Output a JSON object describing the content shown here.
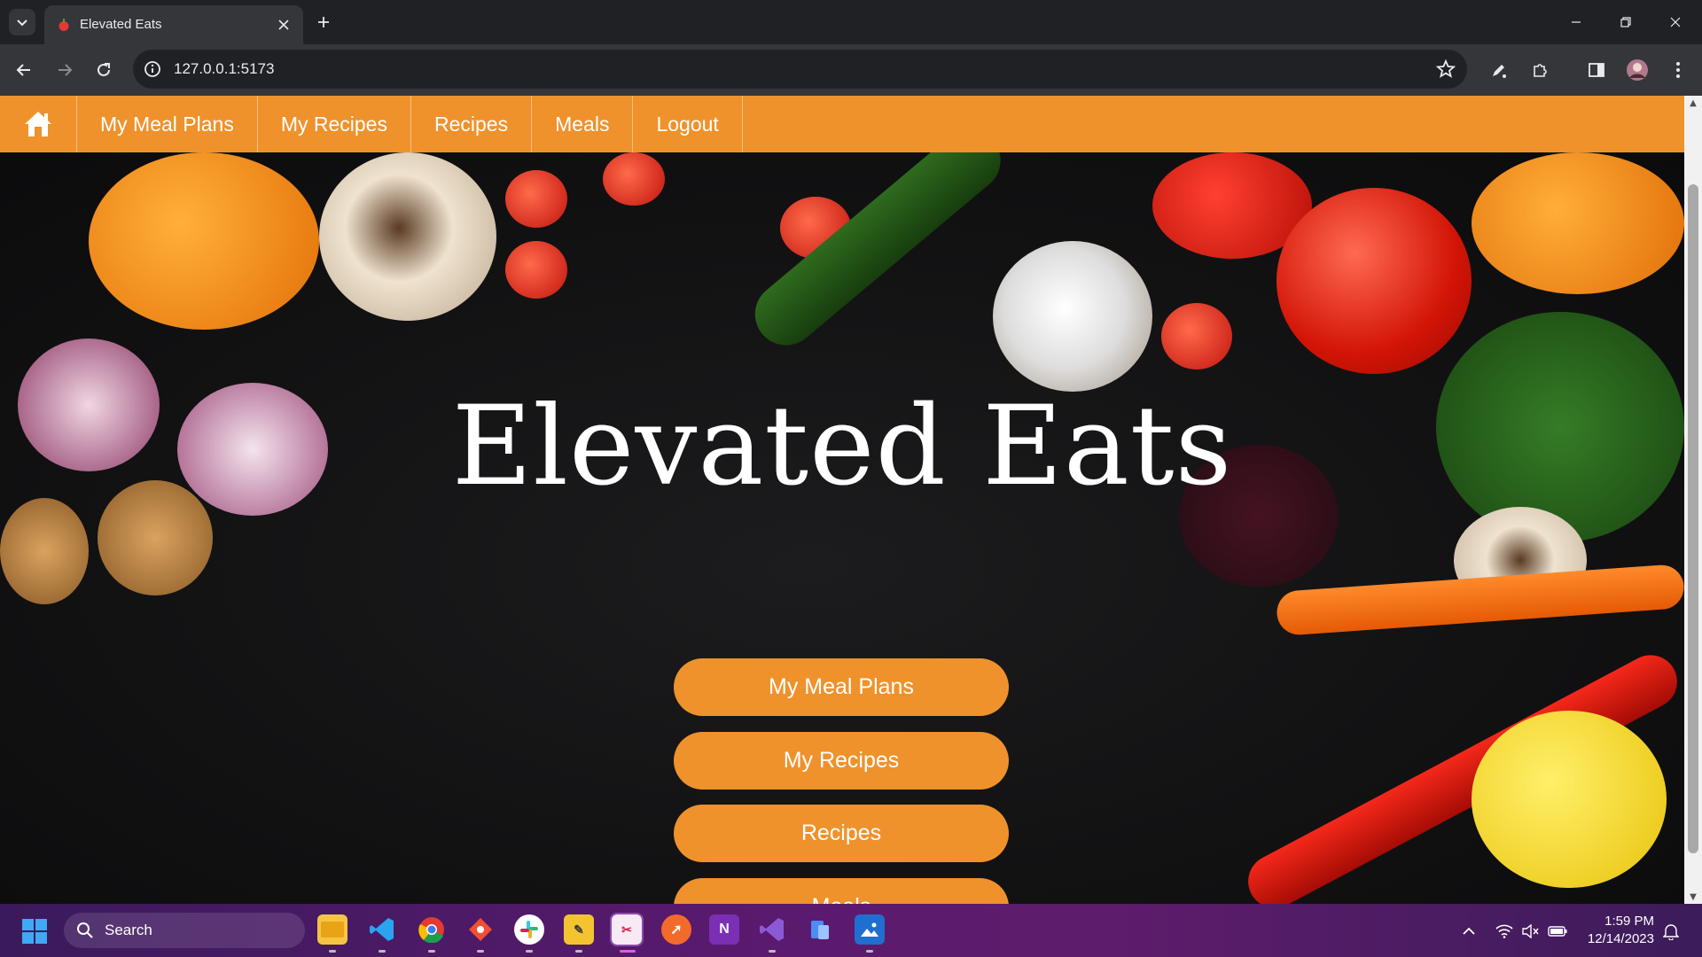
{
  "browser": {
    "tab_title": "Elevated Eats",
    "url": "127.0.0.1:5173"
  },
  "site": {
    "nav": {
      "items": [
        {
          "label": "My Meal Plans"
        },
        {
          "label": "My Recipes"
        },
        {
          "label": "Recipes"
        },
        {
          "label": "Meals"
        },
        {
          "label": "Logout"
        }
      ]
    },
    "hero": {
      "title": "Elevated Eats",
      "buttons": [
        {
          "label": "My Meal Plans"
        },
        {
          "label": "My Recipes"
        },
        {
          "label": "Recipes"
        },
        {
          "label": "Meals"
        }
      ]
    },
    "accent_color": "#ef922c"
  },
  "taskbar": {
    "search_label": "Search",
    "time": "1:59 PM",
    "date": "12/14/2023"
  }
}
